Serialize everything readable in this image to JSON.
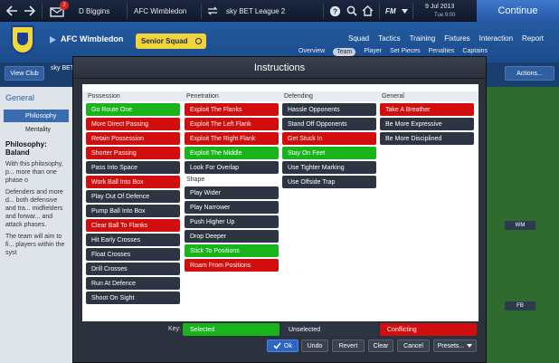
{
  "topbar": {
    "notif_count": "2",
    "manager": "D Biggins",
    "club": "AFC Wimbledon",
    "league": "sky BET League 2",
    "fm_label": "FM",
    "date": "9 Jul 2013",
    "time": "Tue 9:00",
    "continue": "Continue"
  },
  "club_header": {
    "name": "AFC Wimbledon",
    "squad": "Senior Squad",
    "main_tabs": [
      "Squad",
      "Tactics",
      "Training",
      "Fixtures",
      "Interaction",
      "Report"
    ],
    "sub_tabs": [
      "Overview",
      "Team",
      "Player",
      "Set Pieces",
      "Penalties",
      "Captains"
    ]
  },
  "view_club": "View Club",
  "league_short": "sky BET",
  "actions_label": "Actions...",
  "left": {
    "header": "General",
    "items": [
      "Philosophy",
      "Mentality"
    ],
    "philosophy_title": "Philosophy: Baland",
    "text1": "With this philosophy, p... more than one phase o",
    "text2": "Defenders and more d... both defensive and tra... midfielders and forwar... and attack phases.",
    "text3": "The team will aim to fi... players within the syst"
  },
  "pitch": {
    "player1": "WM",
    "player2": "FB"
  },
  "modal": {
    "title": "Instructions",
    "possession": {
      "title": "Possession",
      "items": [
        [
          "Go Route One",
          "s"
        ],
        [
          "More Direct Passing",
          "c"
        ],
        [
          "Retain Possession",
          "c"
        ],
        [
          "Shorter Passing",
          "c"
        ],
        [
          "Pass Into Space",
          "u"
        ],
        [
          "Work Ball Into Box",
          "c"
        ],
        [
          "Play Out Of Defence",
          "u"
        ],
        [
          "Pump Ball Into Box",
          "u"
        ],
        [
          "Clear Ball To Flanks",
          "c"
        ],
        [
          "Hit Early Crosses",
          "u"
        ],
        [
          "Float Crosses",
          "u"
        ],
        [
          "Drill Crosses",
          "u"
        ],
        [
          "Run At Defence",
          "u"
        ],
        [
          "Shoot On Sight",
          "u"
        ]
      ]
    },
    "penetration": {
      "title": "Penetration",
      "items": [
        [
          "Exploit The Flanks",
          "c"
        ],
        [
          "Exploit The Left Flank",
          "c"
        ],
        [
          "Exploit The Right Flank",
          "c"
        ],
        [
          "Exploit The Middle",
          "s"
        ],
        [
          "Look For Overlap",
          "u"
        ]
      ]
    },
    "shape": {
      "title": "Shape",
      "items": [
        [
          "Play Wider",
          "u"
        ],
        [
          "Play Narrower",
          "u"
        ],
        [
          "Push Higher Up",
          "u"
        ],
        [
          "Drop Deeper",
          "u"
        ],
        [
          "Stick To Positions",
          "s"
        ],
        [
          "Roam From Positions",
          "c"
        ]
      ]
    },
    "defending": {
      "title": "Defending",
      "items": [
        [
          "Hassle Opponents",
          "u"
        ],
        [
          "Stand Off Opponents",
          "u"
        ],
        [
          "Get Stuck In",
          "c"
        ],
        [
          "Stay On Feet",
          "s"
        ],
        [
          "Use Tighter Marking",
          "u"
        ],
        [
          "Use Offside Trap",
          "u"
        ]
      ]
    },
    "general": {
      "title": "General",
      "items": [
        [
          "Take A Breather",
          "c"
        ],
        [
          "Be More Expressive",
          "u"
        ],
        [
          "Be More Disciplined",
          "u"
        ]
      ]
    },
    "key": {
      "label": "Key:",
      "selected": "Selected",
      "unselected": "Unselected",
      "conflicting": "Conflicting"
    },
    "buttons": {
      "ok": "Ok",
      "undo": "Undo",
      "revert": "Revert",
      "clear": "Clear",
      "cancel": "Cancel",
      "presets": "Presets..."
    }
  },
  "colors": {
    "selected": "#19b31c",
    "unselected": "#2e3542",
    "conflicting": "#d20d0d"
  }
}
